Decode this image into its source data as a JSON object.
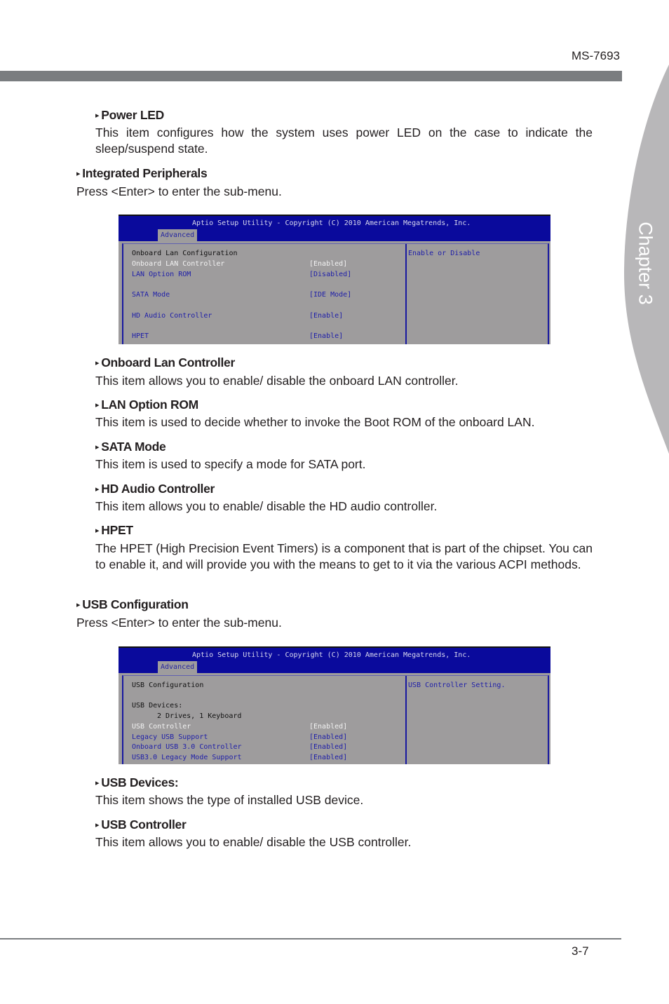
{
  "header": {
    "model": "MS-7693"
  },
  "chapter_tab": {
    "label": "Chapter 3"
  },
  "sections": {
    "power_led": {
      "title": "Power LED",
      "text": "This item configures how the system uses power LED on the case to indicate the sleep/suspend state."
    },
    "integrated_peripherals": {
      "title": "Integrated Peripherals",
      "text": "Press <Enter> to enter the sub-menu."
    },
    "onboard_lan": {
      "title": "Onboard Lan Controller",
      "text": "This item allows you to enable/ disable the onboard LAN controller."
    },
    "lan_option_rom": {
      "title": "LAN Option ROM",
      "text": "This item is used to decide whether to invoke the Boot ROM of the onboard LAN."
    },
    "sata_mode": {
      "title": "SATA Mode",
      "text": "This item is used to specify a mode for SATA port."
    },
    "hd_audio": {
      "title": "HD Audio Controller",
      "text": "This item allows you to enable/ disable the HD audio controller."
    },
    "hpet": {
      "title": "HPET",
      "text": "The HPET (High Precision Event Timers) is a component that is part of the chipset. You can to enable it, and will provide you with the means to get to it via the various ACPI methods."
    },
    "usb_configuration": {
      "title": "USB Configuration",
      "text": "Press <Enter> to enter the sub-menu."
    },
    "usb_devices": {
      "title": "USB Devices:",
      "text": "This item shows the type of installed USB device."
    },
    "usb_controller": {
      "title": "USB Controller",
      "text": "This item allows you to enable/ disable the USB controller."
    }
  },
  "bios1": {
    "title": "Aptio Setup Utility - Copyright (C) 2010 American Megatrends, Inc.",
    "tab": "Advanced",
    "heading": "Onboard Lan Configuration",
    "help": "Enable or Disable",
    "items": [
      {
        "label": "Onboard LAN Controller",
        "value": "[Enabled]"
      },
      {
        "label": "LAN Option ROM",
        "value": "[Disabled]"
      },
      {
        "label": "SATA Mode",
        "value": "[IDE Mode]"
      },
      {
        "label": "HD Audio Controller",
        "value": "[Enable]"
      },
      {
        "label": "HPET",
        "value": "[Enable]"
      }
    ]
  },
  "bios2": {
    "title": "Aptio Setup Utility - Copyright (C) 2010 American Megatrends, Inc.",
    "tab": "Advanced",
    "heading": "USB Configuration",
    "devices_label": "USB Devices:",
    "devices_value": "2 Drives, 1 Keyboard",
    "help": "USB Controller Setting.",
    "items": [
      {
        "label": "USB Controller",
        "value": "[Enabled]"
      },
      {
        "label": "Legacy USB Support",
        "value": "[Enabled]"
      },
      {
        "label": "Onboard USB 3.0 Controller",
        "value": "[Enabled]"
      },
      {
        "label": "USB3.0 Legacy Mode Support",
        "value": "[Enabled]"
      }
    ]
  },
  "footer": {
    "page_number": "3-7"
  }
}
